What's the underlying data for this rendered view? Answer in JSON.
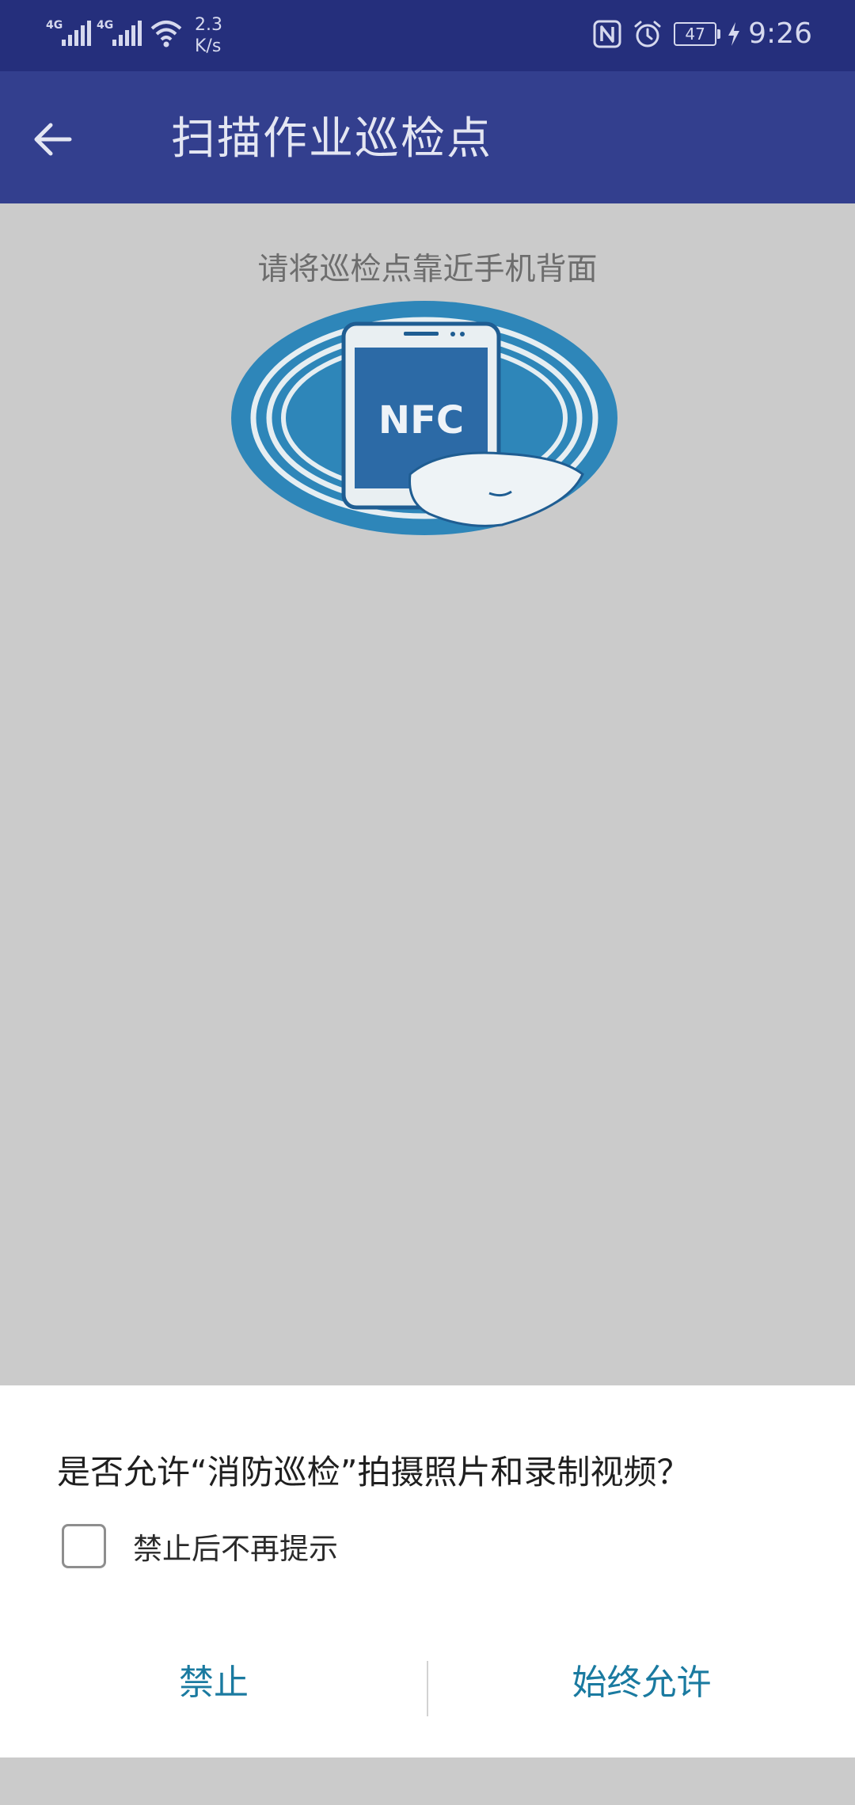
{
  "status_bar": {
    "network1": "4G",
    "network2": "4G",
    "speed_value": "2.3",
    "speed_unit": "K/s",
    "battery": "47",
    "time": "9:26"
  },
  "app_bar": {
    "title": "扫描作业巡检点"
  },
  "content": {
    "hint": "请将巡检点靠近手机背面",
    "nfc_logo_text": "NFC"
  },
  "dialog": {
    "message": "是否允许“消防巡检”拍摄照片和录制视频？",
    "checkbox_label": "禁止后不再提示",
    "checkbox_checked": false,
    "deny_label": "禁止",
    "allow_label": "始终允许",
    "button_color": "#1a7aa0"
  },
  "colors": {
    "status_bar": "#252f7c",
    "app_bar": "#333f8e",
    "scrim": "#cbcbcb"
  }
}
